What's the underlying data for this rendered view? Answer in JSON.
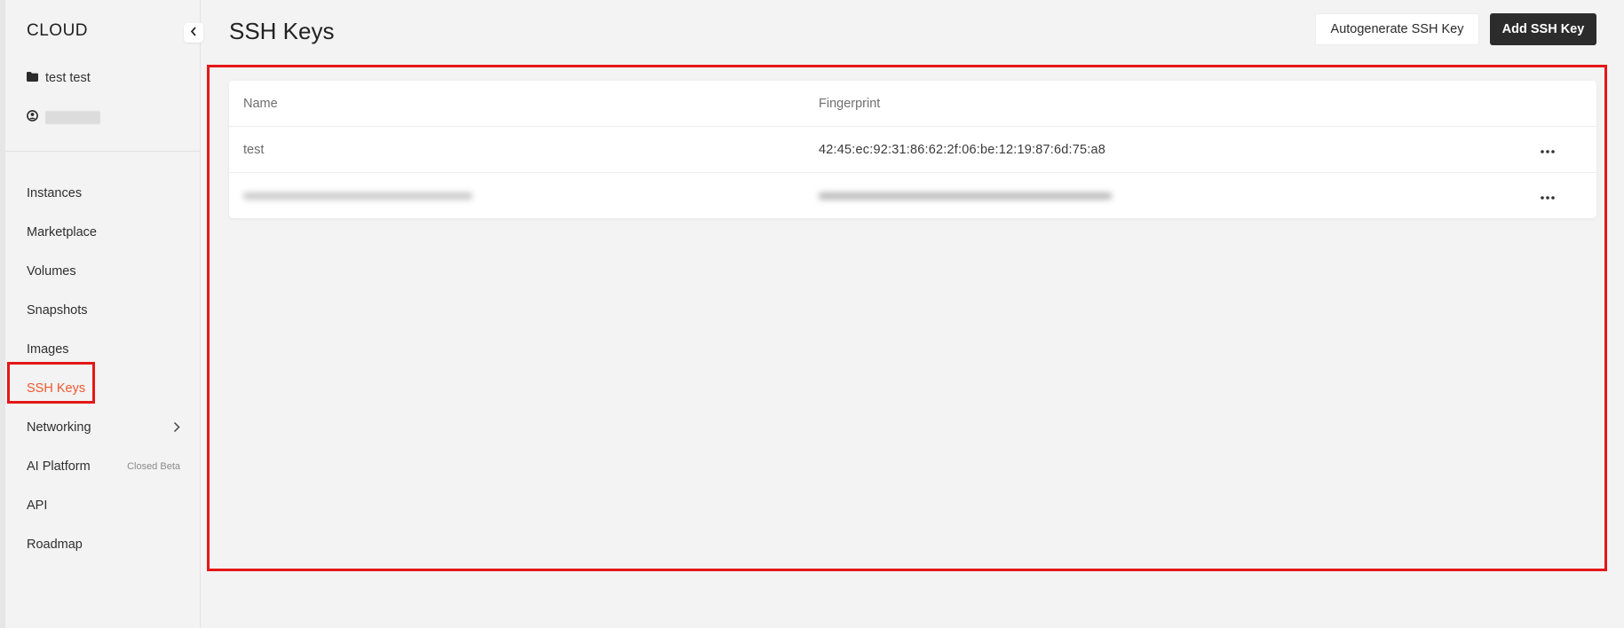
{
  "sidebar": {
    "brand": "CLOUD",
    "project": "test test",
    "account": "",
    "nav": [
      {
        "label": "Instances"
      },
      {
        "label": "Marketplace"
      },
      {
        "label": "Volumes"
      },
      {
        "label": "Snapshots"
      },
      {
        "label": "Images"
      },
      {
        "label": "SSH Keys",
        "active": true
      },
      {
        "label": "Networking"
      },
      {
        "label": "AI Platform",
        "badge": "Closed Beta"
      },
      {
        "label": "API"
      },
      {
        "label": "Roadmap"
      }
    ]
  },
  "header": {
    "title": "SSH Keys",
    "autogenerate_label": "Autogenerate SSH Key",
    "add_label": "Add SSH Key"
  },
  "table": {
    "columns": [
      "Name",
      "Fingerprint"
    ],
    "rows": [
      {
        "name": "test",
        "fingerprint": "42:45:ec:92:31:86:62:2f:06:be:12:19:87:6d:75:a8"
      },
      {
        "name": "",
        "fingerprint": ""
      }
    ]
  },
  "colors": {
    "accent": "#f0572f",
    "highlight": "#e41717",
    "primary_button": "#2c2c2c"
  },
  "icons": [
    "chevron-left-icon",
    "folder-icon",
    "globe-user-icon",
    "chevron-right-icon",
    "more-options-icon"
  ]
}
